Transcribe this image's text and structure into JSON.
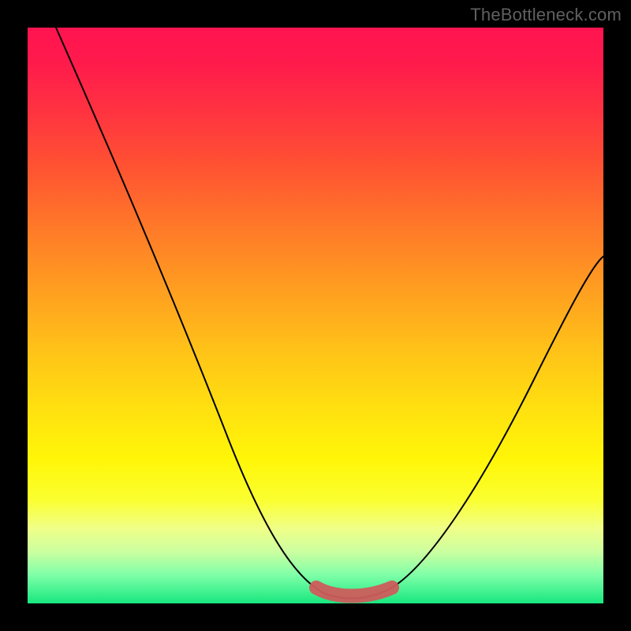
{
  "watermark": {
    "text": "TheBottleneck.com"
  },
  "colors": {
    "page_background": "#000000",
    "watermark_text": "#606060",
    "curve_stroke": "#000000",
    "valley_stroke": "#cd5c5c",
    "gradient_stops": [
      {
        "pct": 0,
        "hex": "#ff1450"
      },
      {
        "pct": 6,
        "hex": "#ff1a4c"
      },
      {
        "pct": 15,
        "hex": "#ff3440"
      },
      {
        "pct": 24,
        "hex": "#ff5232"
      },
      {
        "pct": 35,
        "hex": "#ff7a28"
      },
      {
        "pct": 46,
        "hex": "#ffa020"
      },
      {
        "pct": 56,
        "hex": "#ffc218"
      },
      {
        "pct": 66,
        "hex": "#ffe010"
      },
      {
        "pct": 75,
        "hex": "#fff608"
      },
      {
        "pct": 82,
        "hex": "#fbff30"
      },
      {
        "pct": 87,
        "hex": "#f0ff88"
      },
      {
        "pct": 91,
        "hex": "#ccffa0"
      },
      {
        "pct": 95,
        "hex": "#80ffa8"
      },
      {
        "pct": 100,
        "hex": "#18e880"
      }
    ]
  },
  "chart_data": {
    "type": "line",
    "title": "",
    "xlabel": "",
    "ylabel": "",
    "xlim": [
      0,
      100
    ],
    "ylim": [
      0,
      100
    ],
    "x": [
      5,
      11,
      18,
      25,
      32,
      38,
      44,
      47,
      51,
      55,
      58,
      62,
      66,
      70,
      74,
      79,
      84,
      90,
      96,
      100
    ],
    "values": [
      100,
      91,
      78,
      65,
      52,
      40,
      27,
      18,
      8,
      2,
      1,
      1,
      2,
      5,
      11,
      20,
      30,
      41,
      52,
      60
    ],
    "valley_range_x": [
      53,
      64
    ],
    "notes": "Axes are unlabeled in the image; x and y scales estimated 0–100 from curve position relative to the gradient panel. y=100 corresponds to the top of the colored panel, y=0 to the bottom."
  }
}
